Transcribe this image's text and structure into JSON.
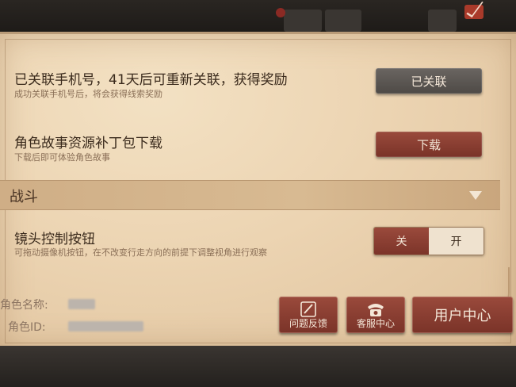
{
  "phone": {
    "title": "已关联手机号，41天后可重新关联，获得奖励",
    "subtitle": "成功关联手机号后，将会获得线索奖励",
    "button_label": "已关联"
  },
  "patch": {
    "title": "角色故事资源补丁包下载",
    "subtitle": "下载后即可体验角色故事",
    "button_label": "下载"
  },
  "section": {
    "title": "战斗",
    "icon": "collapse-triangle-icon"
  },
  "camera": {
    "title": "镜头控制按钮",
    "subtitle": "可拖动摄像机按钮，在不改变行走方向的前提下调整视角进行观察",
    "toggle_off": "关",
    "toggle_on": "开",
    "selected": "关"
  },
  "footer": {
    "role_name_label": "角色名称:",
    "role_id_label": "角色ID:",
    "feedback_label": "问题反馈",
    "service_label": "客服中心",
    "user_center_label": "用户中心"
  },
  "colors": {
    "parchment": "#ecd4b2",
    "button_red": "#8a3f31",
    "button_gray": "#5a5551",
    "text_dark": "#3a2a1c"
  }
}
